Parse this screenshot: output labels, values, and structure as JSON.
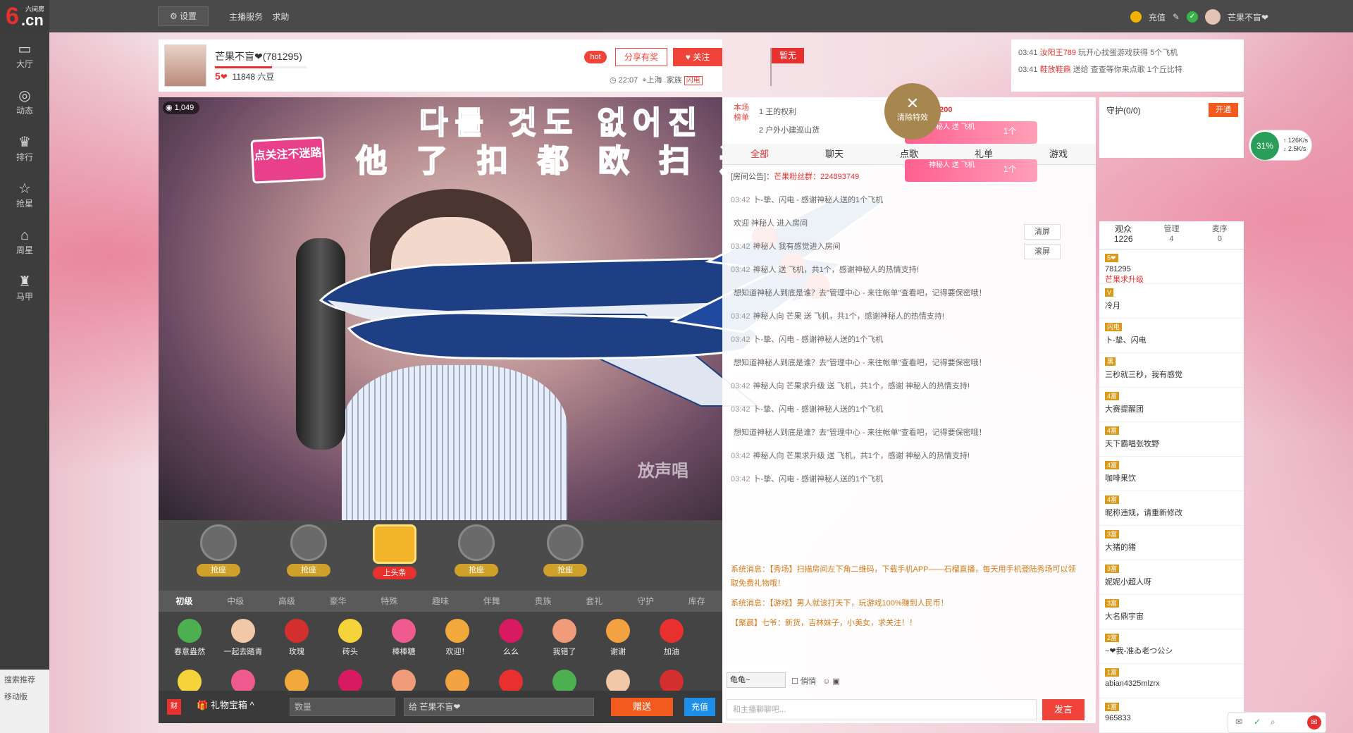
{
  "logo": {
    "text": "6",
    "cn": ".cn",
    "sub": "六间房"
  },
  "topbar": {
    "settings": "⚙ 设置",
    "links": [
      "主播服务",
      "求助"
    ],
    "recharge": "充值",
    "username": "芒果不盲❤"
  },
  "sidebar": [
    {
      "icon": "▭",
      "label": "大厅"
    },
    {
      "icon": "◎",
      "label": "动态"
    },
    {
      "icon": "♛",
      "label": "排行"
    },
    {
      "icon": "☆",
      "label": "抢星"
    },
    {
      "icon": "⌂",
      "label": "周星"
    },
    {
      "icon": "♜",
      "label": "马甲"
    }
  ],
  "sidebar_bottom": [
    "搜索推荐",
    "移动版"
  ],
  "host": {
    "name": "芒果不盲❤(781295)",
    "level": "5",
    "beans": "11848 六豆",
    "progress": 0.62,
    "time": "22:07",
    "city": "上海",
    "home": "家族",
    "tag": "闪电",
    "hot": "hot",
    "share": "分享有奖",
    "follow": "♥ 关注",
    "flag": "暂无"
  },
  "broadcast": [
    {
      "time": "03:41",
      "user": "汝阳王789",
      "text": "玩开心找蛋游戏获得 5个飞机"
    },
    {
      "time": "03:41",
      "user": "鞋放鞋鼎",
      "text": "送给 查查等你来点歌 1个丘比特"
    }
  ],
  "video": {
    "viewers": "1,049",
    "follow_sign": "点关注不迷路",
    "overlay1": "다를 것도 없어진",
    "overlay2": "他了扣都欧扫进",
    "watermark": "放声唱"
  },
  "singers": [
    {
      "label": "抢座"
    },
    {
      "label": "抢座"
    },
    {
      "label": "上头条",
      "main": true
    },
    {
      "label": "抢座"
    },
    {
      "label": "抢座"
    }
  ],
  "gift_tabs": [
    "初级",
    "中级",
    "高级",
    "豪华",
    "特殊",
    "趣味",
    "伴舞",
    "贵族",
    "套礼",
    "守护",
    "库存"
  ],
  "gifts": [
    {
      "name": "春意盎然",
      "color": "#4caf50"
    },
    {
      "name": "一起去踏青",
      "color": "#f2c9a8"
    },
    {
      "name": "玫瑰",
      "color": "#d32f2f"
    },
    {
      "name": "砖头",
      "color": "#f5d33b"
    },
    {
      "name": "棒棒糖",
      "color": "#ef5b8f"
    },
    {
      "name": "欢迎！",
      "color": "#f2a93b"
    },
    {
      "name": "么么",
      "color": "#d81b60"
    },
    {
      "name": "我错了",
      "color": "#f09c7a"
    },
    {
      "name": "谢谢",
      "color": "#f3a241"
    },
    {
      "name": "加油",
      "color": "#e8312f"
    }
  ],
  "gift_bar": {
    "box": "礼物宝箱",
    "qty": "数量",
    "to": "给 芒果不盲❤",
    "send": "赠送",
    "recharge": "充值"
  },
  "rank": {
    "title": "本场榜单",
    "rows": [
      {
        "n": "1",
        "name": "王的权利",
        "amt": "5200"
      },
      {
        "n": "2",
        "name": "户外小建巡山货",
        "amt": "1010"
      }
    ]
  },
  "chat_tabs": [
    "全部",
    "聊天",
    "点歌",
    "礼单",
    "游戏"
  ],
  "notice": {
    "label": "[房间公告]：",
    "text": "芒果粉丝群：224893749"
  },
  "chat": [
    {
      "t": "03:42",
      "text": "卜-挚、闪电 - 感谢神秘人送的1个飞机"
    },
    {
      "t": "",
      "text": "欢迎 神秘人 进入房间"
    },
    {
      "t": "03:42",
      "text": "神秘人 我有感觉进入房间"
    },
    {
      "t": "03:42",
      "text": "神秘人 送 飞机，共1个，感谢神秘人的热情支持!"
    },
    {
      "t": "",
      "text": "想知道神秘人到底是谁？去\"管理中心 - 来往帐单\"查看吧，记得要保密哦！"
    },
    {
      "t": "03:42",
      "text": "神秘人向 芒果 送 飞机，共1个，感谢神秘人的热情支持!"
    },
    {
      "t": "03:42",
      "text": "卜-挚、闪电 - 感谢神秘人送的1个飞机"
    },
    {
      "t": "",
      "text": "想知道神秘人到底是谁？去\"管理中心 - 来往帐单\"查看吧，记得要保密哦！"
    },
    {
      "t": "03:42",
      "text": "神秘人向 芒果求升级 送 飞机，共1个，感谢 神秘人的热情支持!"
    },
    {
      "t": "03:42",
      "text": "卜-挚、闪电 - 感谢神秘人送的1个飞机"
    },
    {
      "t": "",
      "text": "想知道神秘人到底是谁？去\"管理中心 - 来往帐单\"查看吧，记得要保密哦！"
    },
    {
      "t": "03:42",
      "text": "神秘人向 芒果求升级 送 飞机，共1个，感谢 神秘人的热情支持!"
    },
    {
      "t": "03:42",
      "text": "卜-挚、闪电 - 感谢神秘人送的1个飞机"
    }
  ],
  "chat_actions": [
    "清屏",
    "滚屏"
  ],
  "sys": [
    "系统消息：【秀场】扫描房间左下角二维码，下载手机APP——石榴直播，每天用手机登陆秀场可以领取免费礼物哦！",
    "系统消息：【游戏】男人就该打天下，玩游戏100%赚到人民币！",
    "【聚晨】七爷：新货，吉林妹子，小美女，求关注！！"
  ],
  "chat_input": {
    "to": "龟龟~",
    "whisper": "悄悄",
    "placeholder": "和主播聊聊吧...",
    "send": "发言"
  },
  "clear_fx": "清除特效",
  "guard": {
    "title": "守护(0/0)",
    "open": "开通"
  },
  "banners": [
    {
      "text": "神秘人 送 飞机",
      "n": "1个"
    },
    {
      "text": "神秘人 送 飞机",
      "n": "1个"
    }
  ],
  "net": {
    "pct": "31%",
    "up": "126K/s",
    "down": "2.5K/s"
  },
  "audience": {
    "tabs": [
      {
        "label": "观众",
        "n": "1226"
      },
      {
        "label": "管理",
        "n": "4"
      },
      {
        "label": "麦序",
        "n": "0"
      }
    ],
    "users": [
      {
        "badge": "5❤",
        "name": "781295",
        "sub": "芒果求升级"
      },
      {
        "badge": "V",
        "name": "冷月",
        "sub": ""
      },
      {
        "badge": "闪电",
        "name": "卜-挚、闪电",
        "sub": ""
      },
      {
        "badge": "黑",
        "name": "三秒就三秒，我有感觉",
        "sub": ""
      },
      {
        "badge": "4富",
        "name": "大赛提醒团",
        "sub": ""
      },
      {
        "badge": "4富",
        "name": "天下霸唱张牧野",
        "sub": ""
      },
      {
        "badge": "4富",
        "name": "咖啡果饮",
        "sub": ""
      },
      {
        "badge": "4富",
        "name": "昵称违规，请重新修改",
        "sub": ""
      },
      {
        "badge": "3富",
        "name": "大猪的猪",
        "sub": ""
      },
      {
        "badge": "3富",
        "name": "妮妮小超人呀",
        "sub": ""
      },
      {
        "badge": "3富",
        "name": "大名鼎宇宙",
        "sub": ""
      },
      {
        "badge": "2富",
        "name": "~❤我-准ゐ老つ公シ",
        "sub": ""
      },
      {
        "badge": "1富",
        "name": "abian4325mlzrx",
        "sub": ""
      },
      {
        "badge": "1富",
        "name": "965833",
        "sub": ""
      }
    ]
  }
}
